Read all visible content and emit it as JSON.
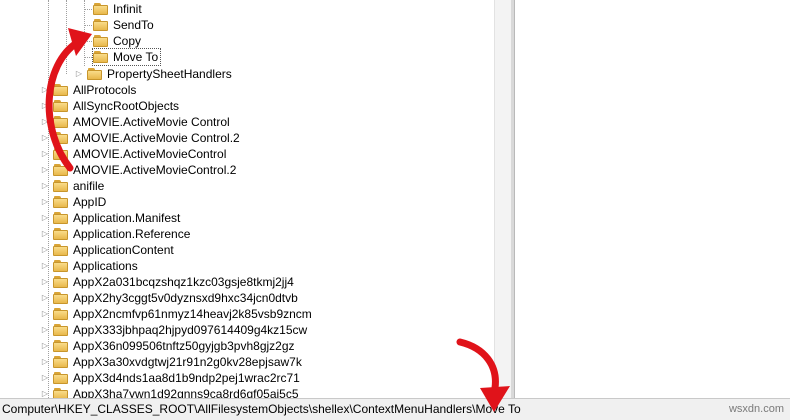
{
  "tree": {
    "subitems": [
      {
        "label": "Infinit"
      },
      {
        "label": "SendTo"
      },
      {
        "label": "Copy"
      },
      {
        "label": "Move To"
      }
    ],
    "property_handler": {
      "label": "PropertySheetHandlers"
    },
    "items": [
      {
        "label": "AllProtocols"
      },
      {
        "label": "AllSyncRootObjects"
      },
      {
        "label": "AMOVIE.ActiveMovie Control"
      },
      {
        "label": "AMOVIE.ActiveMovie Control.2"
      },
      {
        "label": "AMOVIE.ActiveMovieControl"
      },
      {
        "label": "AMOVIE.ActiveMovieControl.2"
      },
      {
        "label": "anifile"
      },
      {
        "label": "AppID"
      },
      {
        "label": "Application.Manifest"
      },
      {
        "label": "Application.Reference"
      },
      {
        "label": "ApplicationContent"
      },
      {
        "label": "Applications"
      },
      {
        "label": "AppX2a031bcqzshqz1kzc03gsje8tkmj2jj4"
      },
      {
        "label": "AppX2hy3cggt5v0dyznsxd9hxc34jcn0dtvb"
      },
      {
        "label": "AppX2ncmfvp61nmyz14heavj2k85vsb9zncm"
      },
      {
        "label": "AppX333jbhpaq2hjpyd097614409g4kz15cw"
      },
      {
        "label": "AppX36n099506tnftz50gyjgb3pvh8gjz2gz"
      },
      {
        "label": "AppX3a30xvdgtwj21r91n2g0kv28epjsaw7k"
      },
      {
        "label": "AppX3d4nds1aa8d1b9ndp2pej1wrac2rc71"
      },
      {
        "label": "AppX3ha7ywn1d92gnns9ca8rd6gf05ai5c5"
      }
    ]
  },
  "statusbar": {
    "path": "Computer\\HKEY_CLASSES_ROOT\\AllFilesystemObjects\\shellex\\ContextMenuHandlers\\Move To"
  },
  "watermark": {
    "text": "wsxdn.com"
  },
  "colors": {
    "arrow": "#e0131a",
    "folder": "#f0c860"
  }
}
